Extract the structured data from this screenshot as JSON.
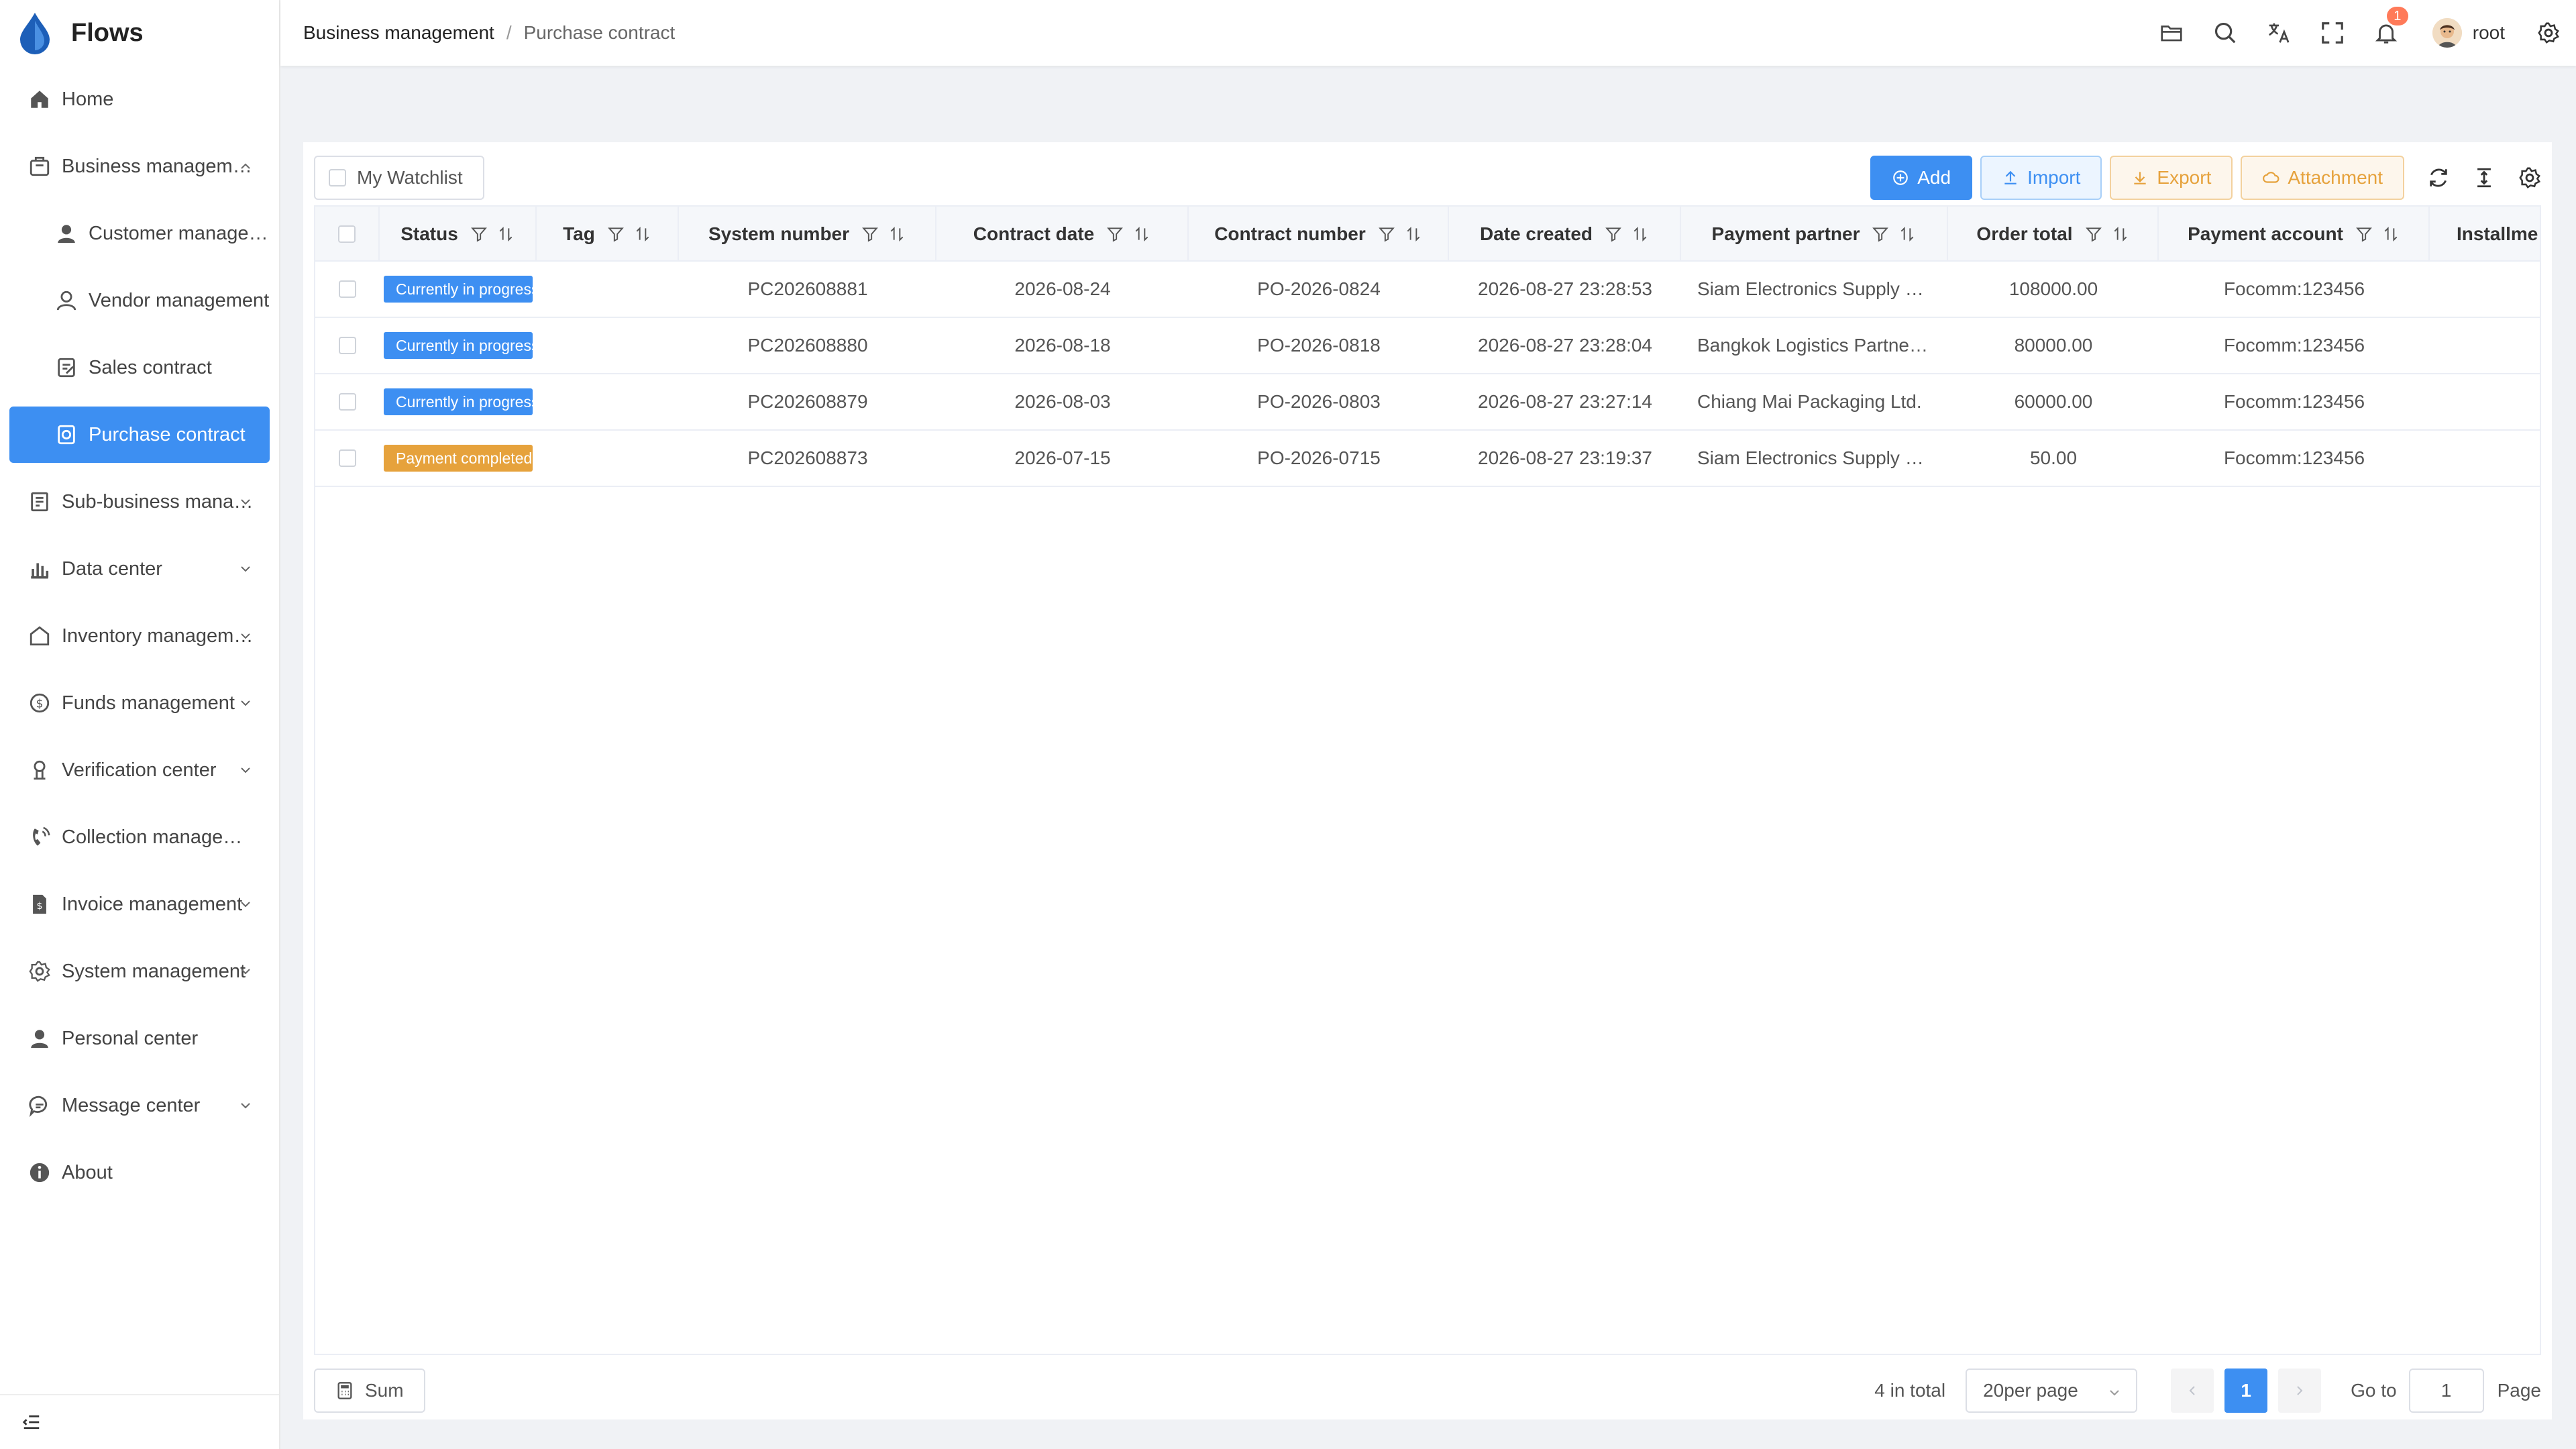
{
  "app": {
    "name": "Flows"
  },
  "sidebar": {
    "items": [
      {
        "label": "Home",
        "icon": "home-icon"
      },
      {
        "label": "Business management",
        "icon": "business-icon",
        "expanded": true
      },
      {
        "label": "Customer management",
        "icon": "customer-icon"
      },
      {
        "label": "Vendor management",
        "icon": "vendor-icon"
      },
      {
        "label": "Sales contract",
        "icon": "sales-contract-icon"
      },
      {
        "label": "Purchase contract",
        "icon": "purchase-contract-icon",
        "active": true
      },
      {
        "label": "Sub-business management",
        "icon": "sub-business-icon"
      },
      {
        "label": "Data center",
        "icon": "data-center-icon"
      },
      {
        "label": "Inventory management",
        "icon": "inventory-icon"
      },
      {
        "label": "Funds management",
        "icon": "funds-icon"
      },
      {
        "label": "Verification center",
        "icon": "verification-icon"
      },
      {
        "label": "Collection management",
        "icon": "collection-icon"
      },
      {
        "label": "Invoice management",
        "icon": "invoice-icon"
      },
      {
        "label": "System management",
        "icon": "system-icon"
      },
      {
        "label": "Personal center",
        "icon": "personal-icon"
      },
      {
        "label": "Message center",
        "icon": "message-icon"
      },
      {
        "label": "About",
        "icon": "about-icon"
      }
    ]
  },
  "header": {
    "breadcrumb": [
      "Business management",
      "Purchase contract"
    ],
    "notifications": "1",
    "username": "root"
  },
  "toolbar": {
    "watchlist": "My Watchlist",
    "add": "Add",
    "import": "Import",
    "export": "Export",
    "attachment": "Attachment"
  },
  "table": {
    "columns": [
      "Status",
      "Tag",
      "System number",
      "Contract date",
      "Contract number",
      "Date created",
      "Payment partner",
      "Order total",
      "Payment account",
      "Installme"
    ],
    "rows": [
      {
        "status": "Currently in progress",
        "status_color": "#3d8ff2",
        "tag": "",
        "system_number": "PC202608881",
        "contract_date": "2026-08-24",
        "contract_number": "PO-2026-0824",
        "date_created": "2026-08-27 23:28:53",
        "payment_partner": "Siam Electronics Supply Co., Ltd.",
        "order_total": "108000.00",
        "payment_account": "Focomm:123456",
        "installment": ""
      },
      {
        "status": "Currently in progress",
        "status_color": "#3d8ff2",
        "tag": "",
        "system_number": "PC202608880",
        "contract_date": "2026-08-18",
        "contract_number": "PO-2026-0818",
        "date_created": "2026-08-27 23:28:04",
        "payment_partner": "Bangkok Logistics Partners Co., Ltd.",
        "order_total": "80000.00",
        "payment_account": "Focomm:123456",
        "installment": ""
      },
      {
        "status": "Currently in progress",
        "status_color": "#3d8ff2",
        "tag": "",
        "system_number": "PC202608879",
        "contract_date": "2026-08-03",
        "contract_number": "PO-2026-0803",
        "date_created": "2026-08-27 23:27:14",
        "payment_partner": "Chiang Mai Packaging Ltd.",
        "order_total": "60000.00",
        "payment_account": "Focomm:123456",
        "installment": ""
      },
      {
        "status": "Payment completed",
        "status_color": "#e6a23c",
        "tag": "",
        "system_number": "PC202608873",
        "contract_date": "2026-07-15",
        "contract_number": "PO-2026-0715",
        "date_created": "2026-08-27 23:19:37",
        "payment_partner": "Siam Electronics Supply Co., Ltd.",
        "order_total": "50.00",
        "payment_account": "Focomm:123456",
        "installment": ""
      }
    ]
  },
  "footer": {
    "sum": "Sum",
    "total": "4 in total",
    "per_page": "20per page",
    "current_page": "1",
    "goto_label": "Go to",
    "goto_value": "1",
    "page_label": "Page"
  }
}
